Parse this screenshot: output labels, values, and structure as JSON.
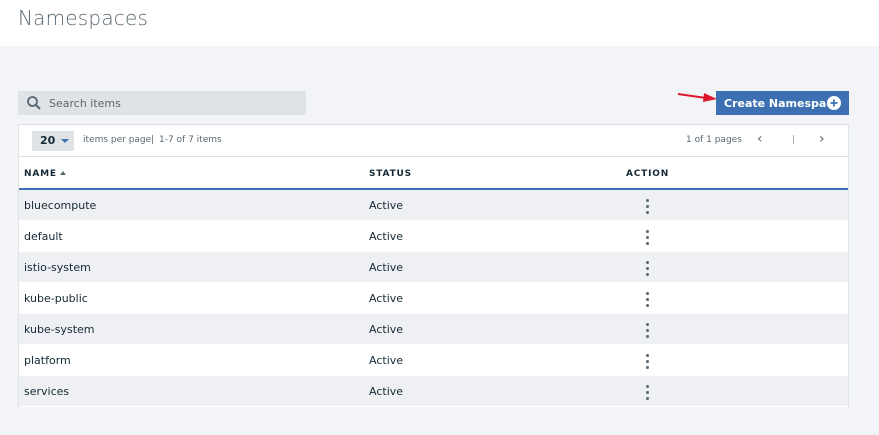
{
  "header": {
    "title": "Namespaces"
  },
  "search": {
    "placeholder": "Search items"
  },
  "toolbar": {
    "create_label": "Create Namespace"
  },
  "pagination": {
    "page_size": "20",
    "per_page_label": "items per page",
    "separator": "|",
    "range_label": "1-7 of 7 items",
    "pages_label": "1 of 1 pages",
    "prev_glyph": "‹",
    "divider": "|",
    "next_glyph": "›"
  },
  "table": {
    "columns": {
      "name": "NAME",
      "status": "STATUS",
      "action": "ACTION"
    },
    "rows": [
      {
        "name": "bluecompute",
        "status": "Active"
      },
      {
        "name": "default",
        "status": "Active"
      },
      {
        "name": "istio-system",
        "status": "Active"
      },
      {
        "name": "kube-public",
        "status": "Active"
      },
      {
        "name": "kube-system",
        "status": "Active"
      },
      {
        "name": "platform",
        "status": "Active"
      },
      {
        "name": "services",
        "status": "Active"
      }
    ]
  },
  "colors": {
    "accent": "#3d70b2",
    "arrow": "#e0182d"
  },
  "icons": {
    "search": "search-icon",
    "add": "add-circle-icon",
    "overflow": "overflow-menu-icon",
    "annotation": "red-arrow-icon"
  }
}
